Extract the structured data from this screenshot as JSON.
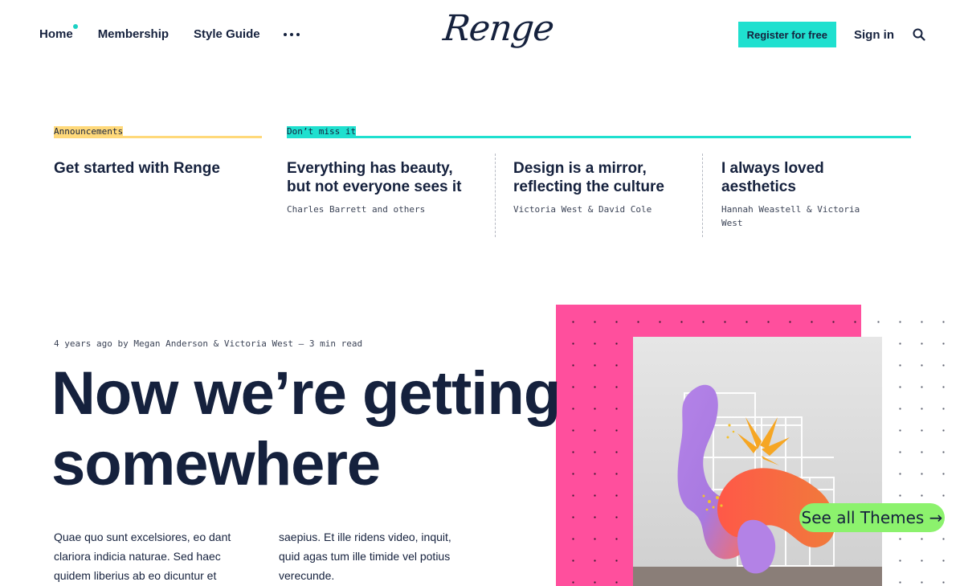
{
  "nav": {
    "links": [
      "Home",
      "Membership",
      "Style Guide"
    ],
    "logo": "Renge",
    "register_label": "Register for free",
    "signin_label": "Sign in"
  },
  "strip": {
    "announcements_label": "Announcements",
    "dont_miss_label": "Don’t miss it",
    "cards": [
      {
        "title": "Get started with Renge",
        "author": ""
      },
      {
        "title": "Everything has beauty, but not everyone sees it",
        "author": "Charles Barrett and others"
      },
      {
        "title": "Design is a mirror, reflecting the culture",
        "author": "Victoria West & David Cole"
      },
      {
        "title": "I always loved aesthetics",
        "author": "Hannah Weastell & Victoria West"
      }
    ]
  },
  "hero": {
    "meta": "4 years ago by Megan Anderson & Victoria West — 3 min read",
    "title": "Now we’re getting somewhere",
    "body_col1": "Quae quo sunt excelsiores, eo dant clariora indicia naturae. Sed haec quidem liberius ab eo dicuntur et",
    "body_col2": "saepius. Et ille ridens video, inquit, quid agas tum ille timide vel potius verecunde."
  },
  "themes_button": "See all Themes →",
  "colors": {
    "accent_teal": "#1fe0cf",
    "accent_yellow": "#ffd97a",
    "accent_pink": "#ff4f9d",
    "accent_green": "#8cf26d",
    "text_dark": "#15213d"
  },
  "icons": [
    "more-icon",
    "search-icon"
  ]
}
